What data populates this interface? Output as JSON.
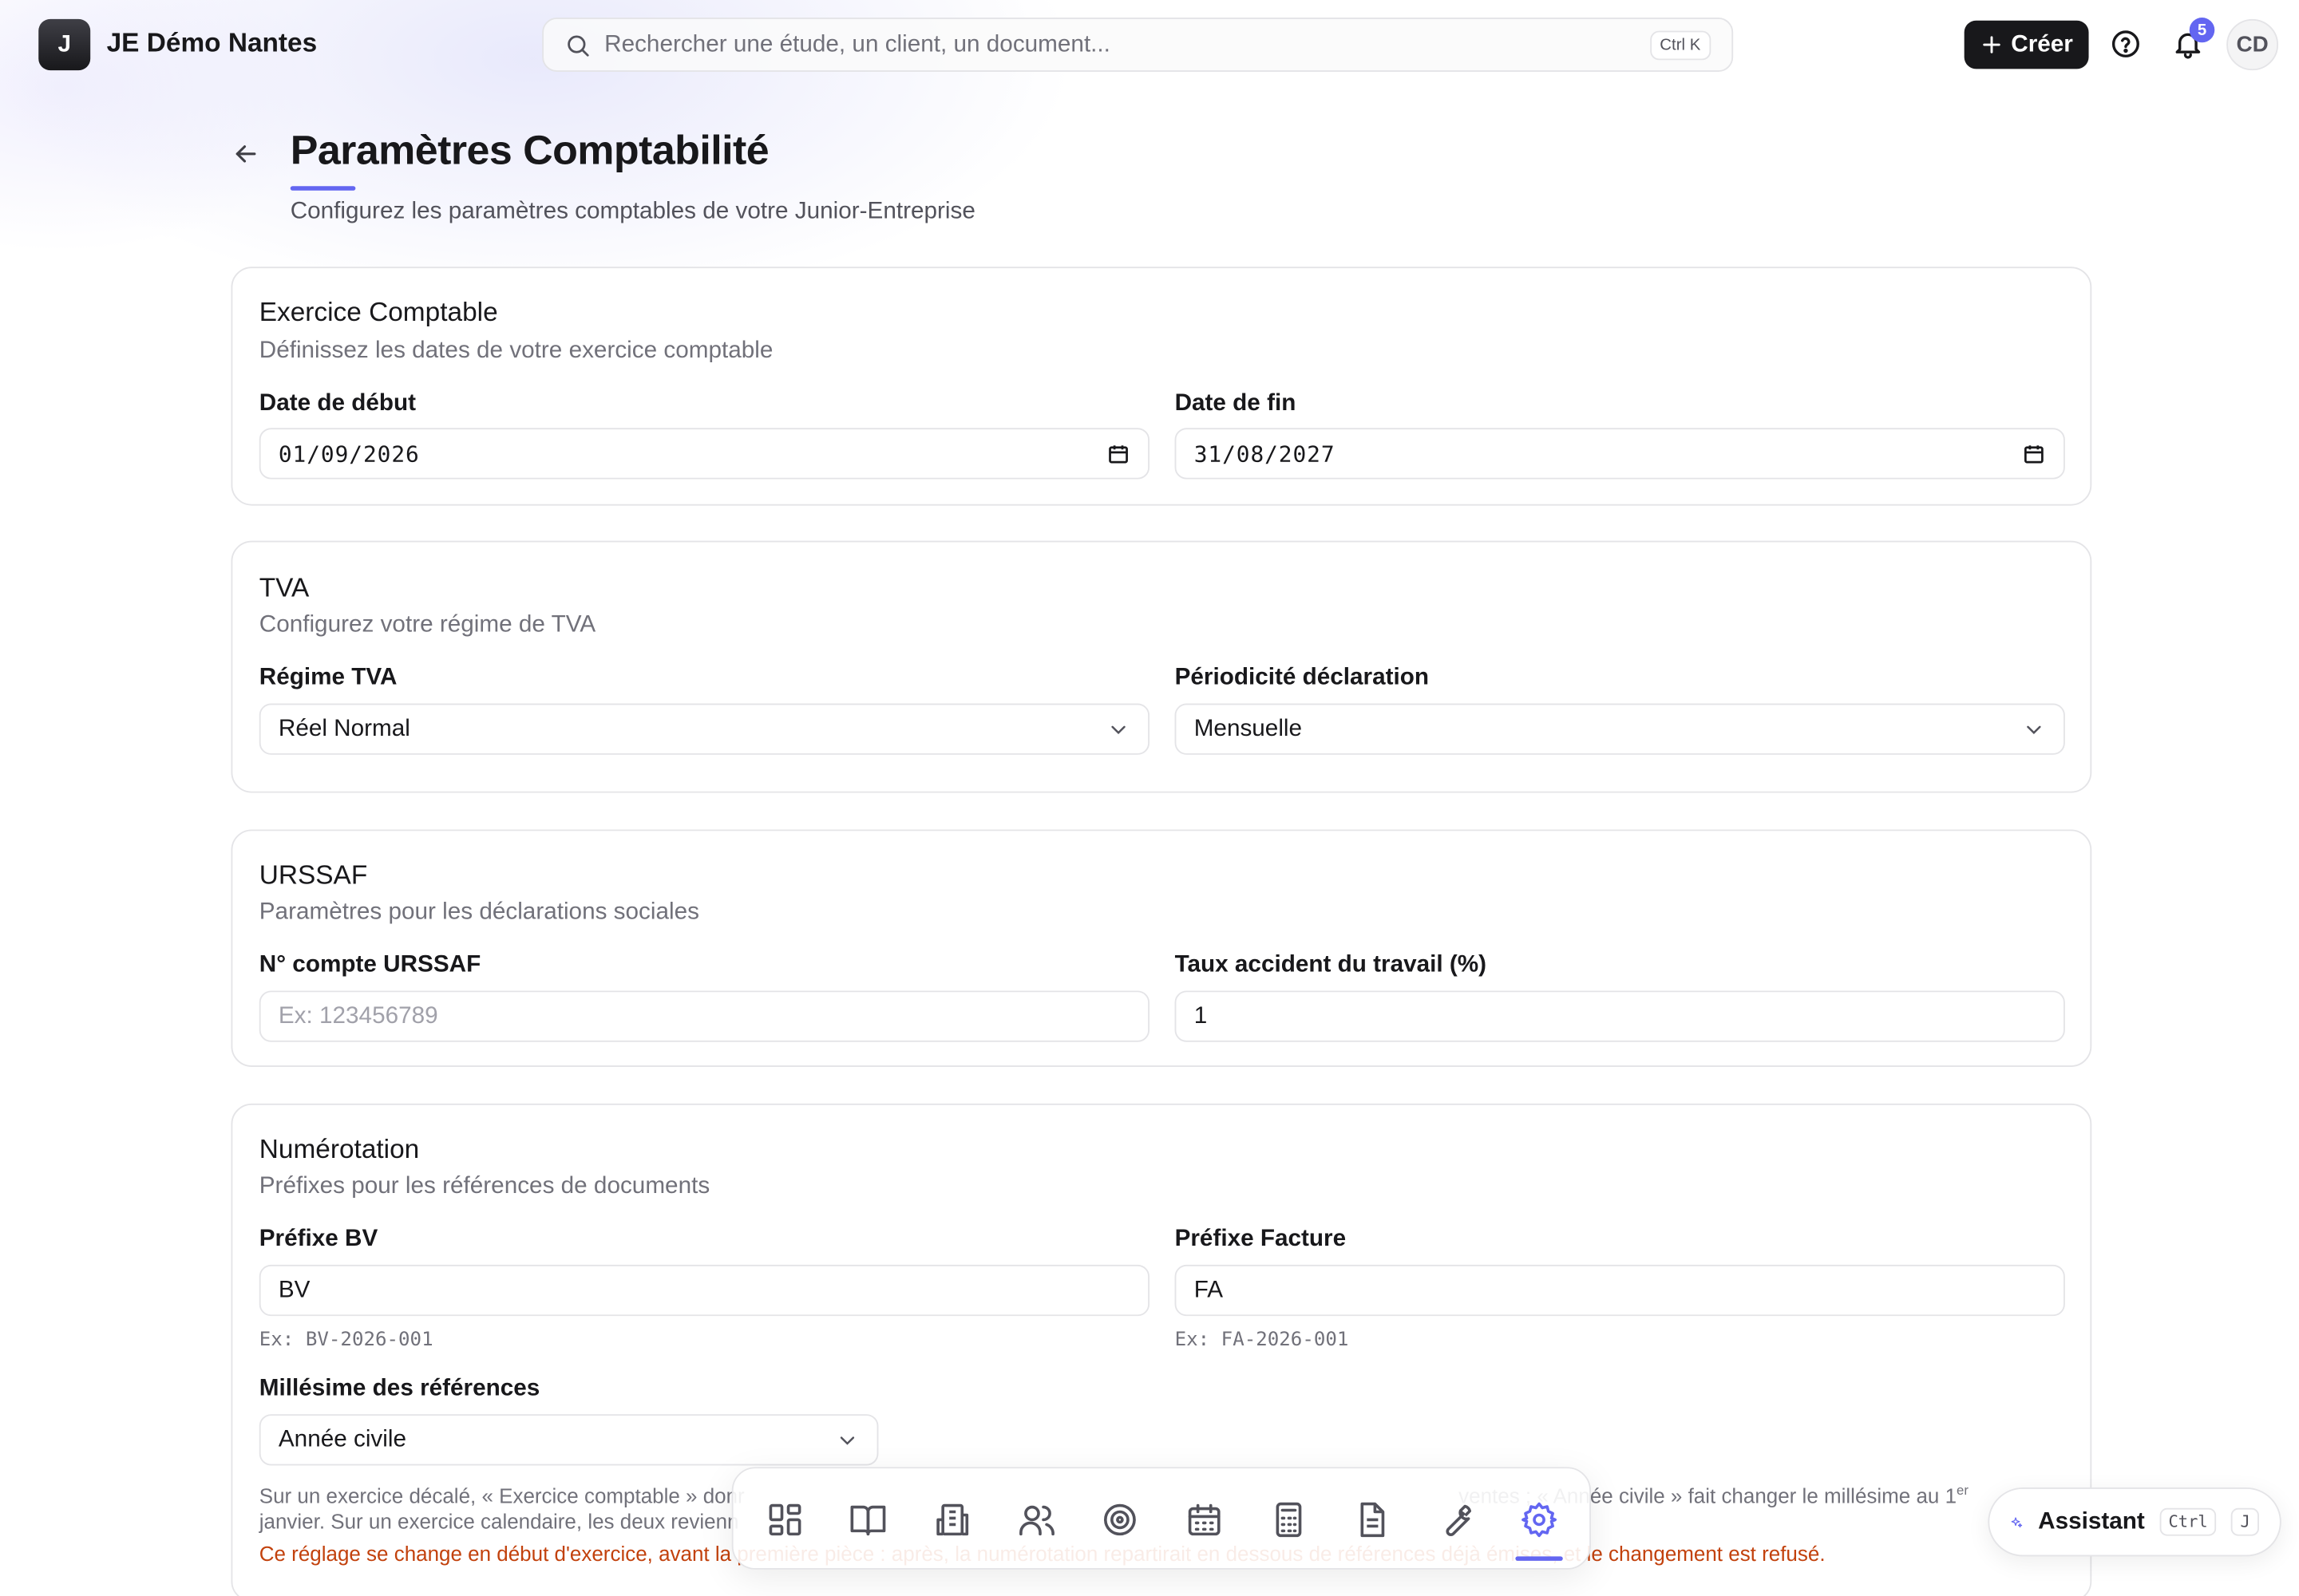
{
  "header": {
    "logo_letter": "J",
    "org_name": "JE Démo Nantes",
    "search_placeholder": "Rechercher une étude, un client, un document...",
    "search_shortcut": "Ctrl K",
    "create_label": "Créer",
    "notification_count": "5",
    "avatar_initials": "CD"
  },
  "page": {
    "title": "Paramètres Comptabilité",
    "subtitle": "Configurez les paramètres comptables de votre Junior-Entreprise"
  },
  "exercice": {
    "title": "Exercice Comptable",
    "description": "Définissez les dates de votre exercice comptable",
    "start_label": "Date de début",
    "start_value": "01/09/2026",
    "end_label": "Date de fin",
    "end_value": "31/08/2027"
  },
  "tva": {
    "title": "TVA",
    "description": "Configurez votre régime de TVA",
    "regime_label": "Régime TVA",
    "regime_value": "Réel Normal",
    "periodicity_label": "Périodicité déclaration",
    "periodicity_value": "Mensuelle"
  },
  "urssaf": {
    "title": "URSSAF",
    "description": "Paramètres pour les déclarations sociales",
    "account_label": "N° compte URSSAF",
    "account_placeholder": "Ex: 123456789",
    "rate_label": "Taux accident du travail (%)",
    "rate_value": "1"
  },
  "numerotation": {
    "title": "Numérotation",
    "description": "Préfixes pour les références de documents",
    "bv_label": "Préfixe BV",
    "bv_value": "BV",
    "bv_hint": "Ex: BV-2026-001",
    "invoice_label": "Préfixe Facture",
    "invoice_value": "FA",
    "invoice_hint": "Ex: FA-2026-001",
    "millesime_label": "Millésime des références",
    "millesime_value": "Année civile",
    "note_line1_a": "Sur un exercice décalé, « Exercice comptable » donr",
    "note_line1_b": "ventes ; « Année civile » fait changer le millésime au 1",
    "note_line1_sup": "er",
    "note_line2": "janvier. Sur un exercice calendaire, les deux revienn",
    "warning": "Ce réglage se change en début d'exercice, avant la première pièce : après, la numérotation repartirait en dessous de références déjà émises, et le changement est refusé."
  },
  "dock": {
    "items": [
      "dashboard-icon",
      "book-icon",
      "building-icon",
      "users-icon",
      "target-icon",
      "calendar-icon",
      "calculator-icon",
      "document-icon",
      "wrench-icon",
      "settings-icon"
    ],
    "active": "settings-icon"
  },
  "assistant": {
    "label": "Assistant",
    "key1": "Ctrl",
    "key2": "J"
  },
  "colors": {
    "accent": "#6366f1",
    "primary": "#18181b",
    "warning": "#c2410c",
    "border": "#e4e4e7"
  }
}
